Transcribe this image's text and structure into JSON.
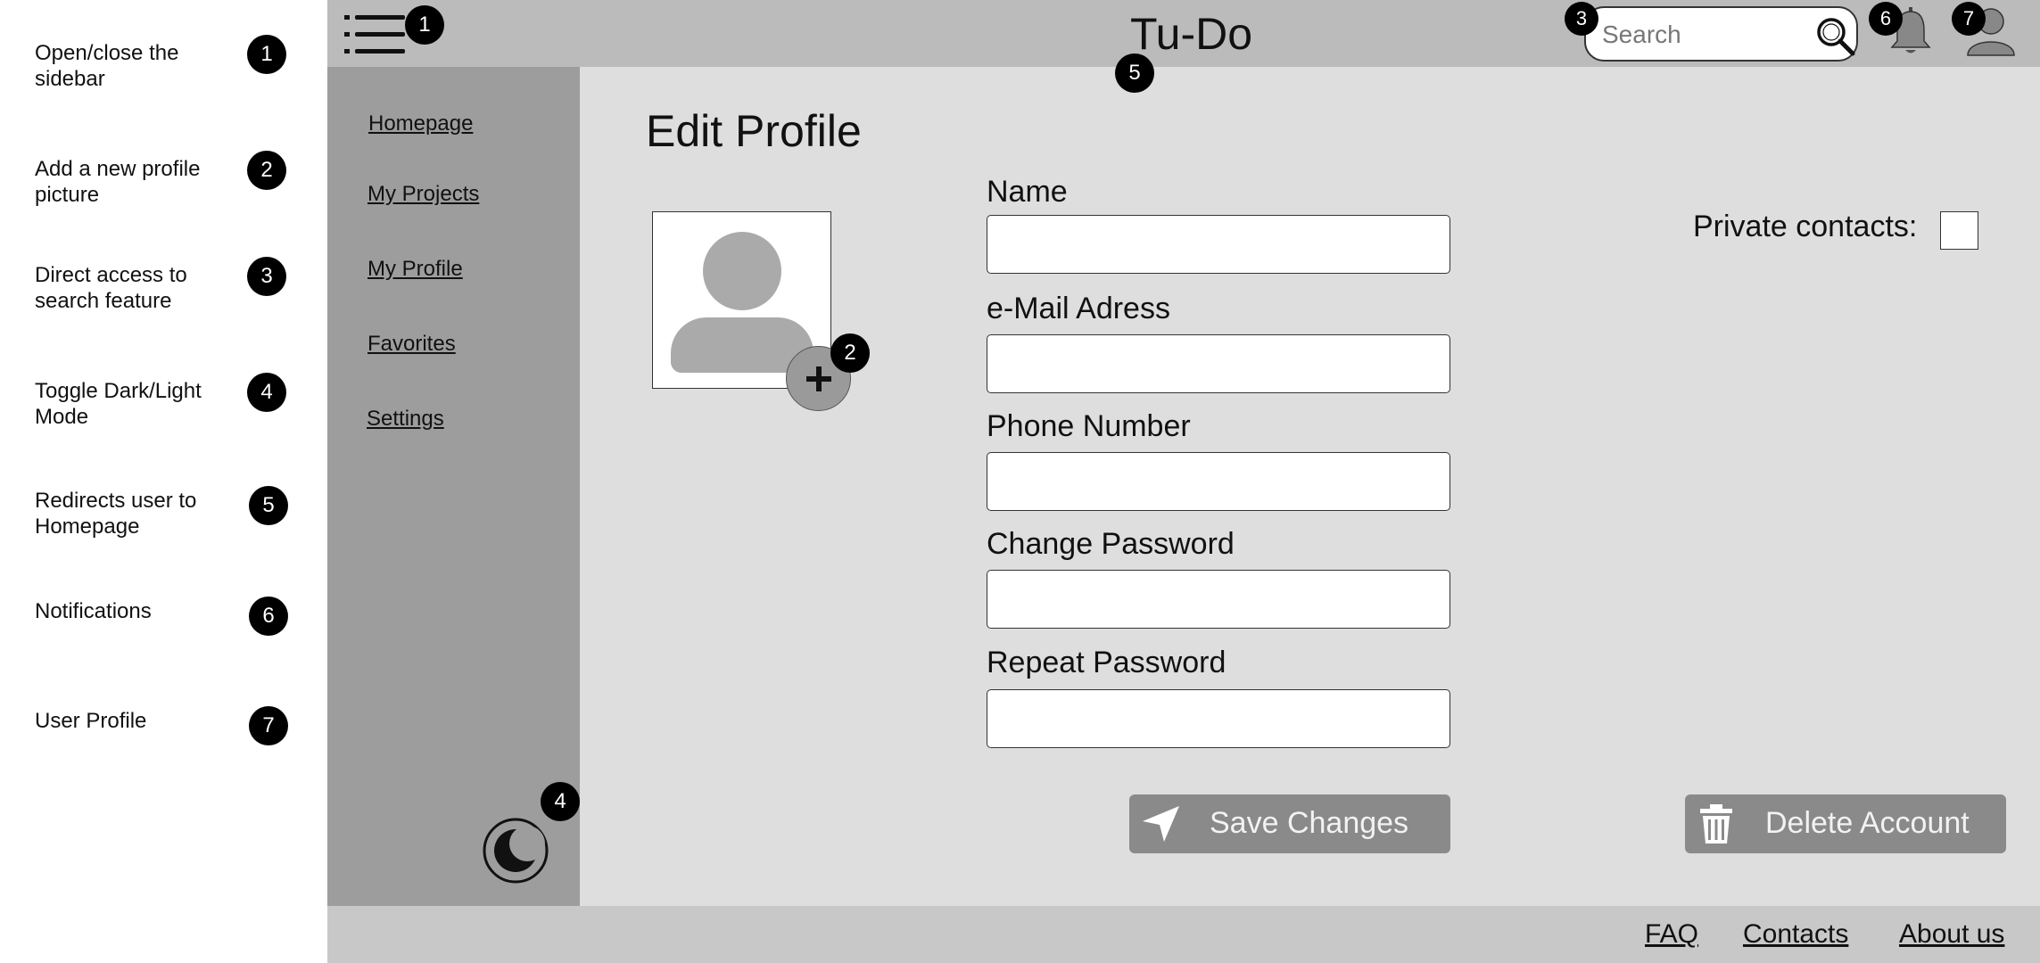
{
  "legend": [
    {
      "number": "1",
      "text": "Open/close the sidebar"
    },
    {
      "number": "2",
      "text": "Add a new profile picture"
    },
    {
      "number": "3",
      "text": "Direct access to search feature"
    },
    {
      "number": "4",
      "text": "Toggle Dark/Light Mode"
    },
    {
      "number": "5",
      "text": "Redirects user to Homepage"
    },
    {
      "number": "6",
      "text": "Notifications"
    },
    {
      "number": "7",
      "text": "User Profile"
    }
  ],
  "header": {
    "brand": "Tu-Do",
    "search_placeholder": "Search",
    "menu_icon": "hamburger-icon",
    "search_icon": "magnifier-icon",
    "notification_icon": "bell-icon",
    "profile_icon": "user-icon"
  },
  "callouts": {
    "menu": "1",
    "add_photo": "2",
    "search": "3",
    "theme": "4",
    "brand": "5",
    "notifications": "6",
    "profile": "7"
  },
  "sidebar": {
    "items": [
      {
        "label": "Homepage"
      },
      {
        "label": "My Projects"
      },
      {
        "label": "My Profile"
      },
      {
        "label": "Favorites"
      },
      {
        "label": "Settings"
      }
    ],
    "theme_toggle_icon": "moon-icon"
  },
  "main": {
    "title": "Edit Profile",
    "fields": [
      {
        "label": "Name",
        "value": ""
      },
      {
        "label": "e-Mail Adress",
        "value": ""
      },
      {
        "label": "Phone Number",
        "value": ""
      },
      {
        "label": "Change Password",
        "value": ""
      },
      {
        "label": "Repeat Password",
        "value": ""
      }
    ],
    "private_contacts_label": "Private contacts:",
    "private_contacts_checked": false,
    "save_label": "Save Changes",
    "delete_label": "Delete Account"
  },
  "footer": {
    "links": [
      {
        "label": "FAQ"
      },
      {
        "label": "Contacts"
      },
      {
        "label": "About us"
      }
    ]
  },
  "colors": {
    "topbar": "#bbbbbb",
    "sidebar": "#9d9d9d",
    "content": "#dedede",
    "footer": "#c8c8c8",
    "button": "#8a8a8a",
    "badge": "#000000"
  }
}
